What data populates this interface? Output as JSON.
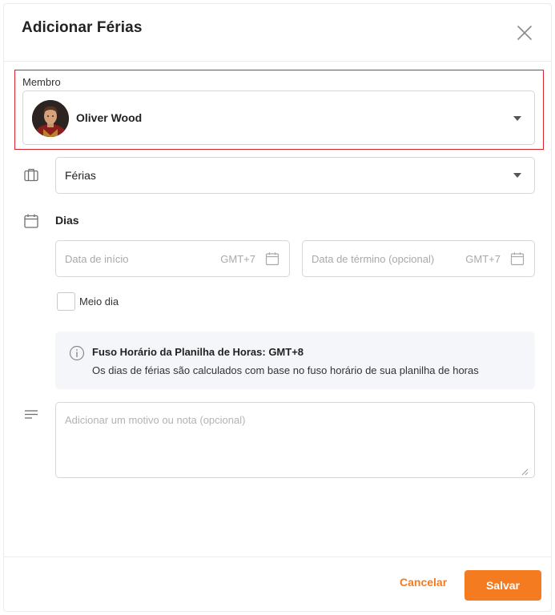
{
  "dialog": {
    "title": "Adicionar Férias"
  },
  "member": {
    "label": "Membro",
    "selected_name": "Oliver Wood"
  },
  "leave_type": {
    "selected": "Férias"
  },
  "days": {
    "label": "Dias",
    "start_placeholder": "Data de início",
    "start_timezone": "GMT+7",
    "end_placeholder": "Data de término (opcional)",
    "end_timezone": "GMT+7"
  },
  "half_day": {
    "label": "Meio dia",
    "checked": false
  },
  "info": {
    "title": "Fuso Horário da Planilha de Horas: GMT+8",
    "text": "Os dias de férias são calculados com base no fuso horário de sua planilha de horas"
  },
  "note": {
    "placeholder": "Adicionar um motivo ou nota (opcional)",
    "value": ""
  },
  "footer": {
    "cancel_label": "Cancelar",
    "save_label": "Salvar"
  },
  "colors": {
    "accent": "#f47b20",
    "highlight_border": "#d9232d"
  },
  "icons": {
    "close": "close-icon",
    "dropdown": "chevron-down-icon",
    "leave_type": "briefcase-icon",
    "days": "calendar-icon",
    "date_picker": "calendar-icon",
    "info": "info-icon",
    "note": "notes-lines-icon"
  }
}
